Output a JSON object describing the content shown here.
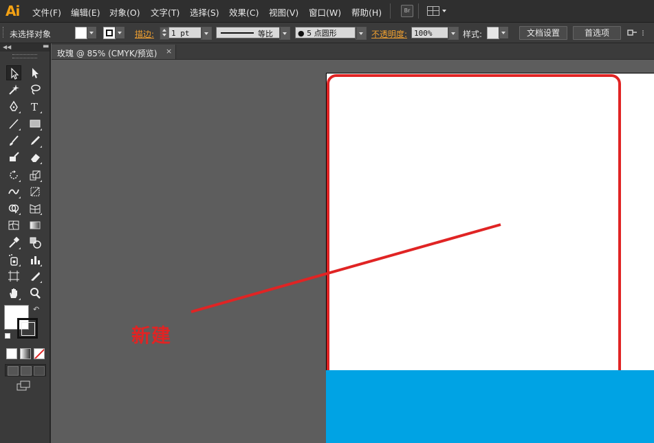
{
  "app": {
    "logo": "Ai"
  },
  "menu": [
    "文件(F)",
    "编辑(E)",
    "对象(O)",
    "文字(T)",
    "选择(S)",
    "效果(C)",
    "视图(V)",
    "窗口(W)",
    "帮助(H)"
  ],
  "menubar_icons": {
    "bridge": "Br",
    "workspace": "workspace-switcher-icon"
  },
  "control_bar": {
    "selection_label": "未选择对象",
    "stroke_label": "描边:",
    "stroke_weight": "1 pt",
    "stroke_profile": "等比",
    "brush": "● 5 点圆形",
    "opacity_label": "不透明度:",
    "opacity_value": "100%",
    "style_label": "样式:",
    "doc_setup_button": "文档设置",
    "preferences_button": "首选项"
  },
  "document_tab": {
    "title": "玫瑰 @ 85% (CMYK/预览)",
    "close": "×"
  },
  "annotation": {
    "text": "新建",
    "color": "#e02424"
  },
  "colors": {
    "accent_red": "#e02424",
    "blue_band": "#00a3e4",
    "logo": "#f4a214"
  }
}
